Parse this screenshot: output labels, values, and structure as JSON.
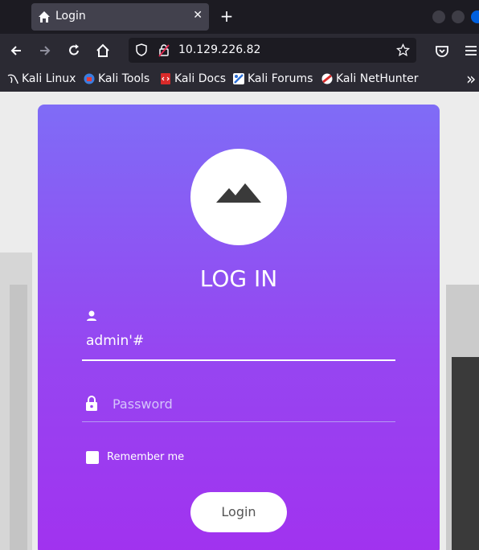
{
  "browser": {
    "tab_title": "Login",
    "tab_close_glyph": "✕",
    "new_tab_glyph": "+",
    "url": "10.129.226.82",
    "bookmarks": [
      {
        "label": "Kali Linux",
        "icon": "kali-dragon-icon"
      },
      {
        "label": "Kali Tools",
        "icon": "kali-tools-icon"
      },
      {
        "label": "Kali Docs",
        "icon": "kali-docs-icon"
      },
      {
        "label": "Kali Forums",
        "icon": "kali-forums-icon"
      },
      {
        "label": "Kali NetHunter",
        "icon": "kali-nethunter-icon"
      }
    ],
    "overflow_glyph": "»"
  },
  "login": {
    "title": "LOG IN",
    "username_value": "admin'#",
    "password_placeholder": "Password",
    "remember_label": "Remember me",
    "button_label": "Login"
  },
  "colors": {
    "accent_top": "#7f6cf6",
    "accent_bottom": "#a132ef",
    "url_bar": "#1c1b22"
  }
}
